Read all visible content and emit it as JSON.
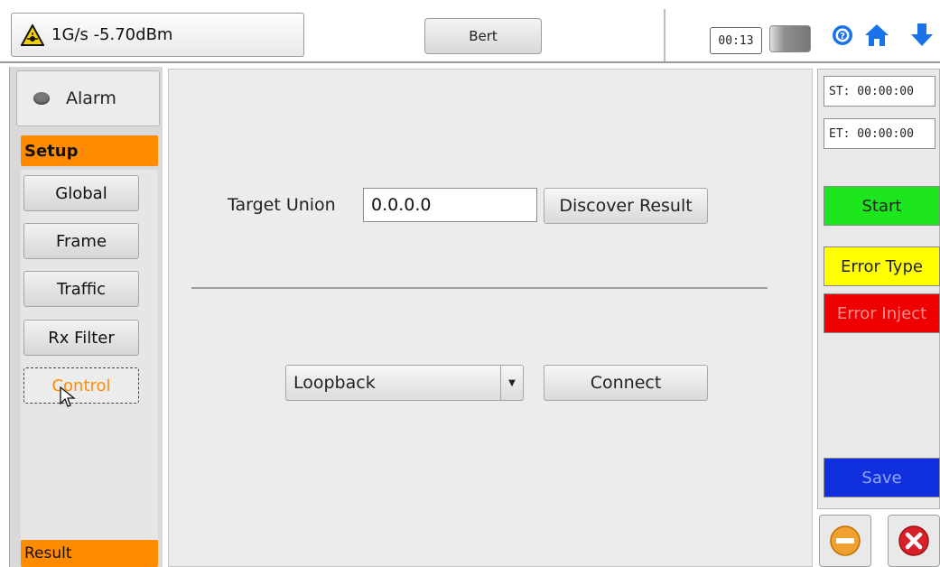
{
  "header": {
    "signal_text": "1G/s -5.70dBm",
    "mode_label": "Bert",
    "timer": "00:13"
  },
  "icons": {
    "warning": "laser-warning-icon",
    "battery": "battery-icon",
    "help": "help-icon",
    "home": "home-icon",
    "download": "down-arrow-icon"
  },
  "sidebar": {
    "alarm_label": "Alarm",
    "setup_header": "Setup",
    "items": [
      {
        "label": "Global"
      },
      {
        "label": "Frame"
      },
      {
        "label": "Traffic"
      },
      {
        "label": "Rx Filter"
      },
      {
        "label": "Control",
        "active": true
      }
    ],
    "result_header": "Result"
  },
  "main": {
    "target_union_label": "Target Union",
    "target_union_value": "0.0.0.0",
    "discover_button": "Discover Result",
    "mode_select_value": "Loopback",
    "connect_button": "Connect"
  },
  "right_panel": {
    "start_time": "ST:  00:00:00",
    "end_time": "ET:  00:00:00",
    "start_button": "Start",
    "error_type_button": "Error Type",
    "error_inject_button": "Error Inject",
    "save_button": "Save"
  },
  "colors": {
    "accent_orange": "#ff8c00",
    "start_green": "#1ee61e",
    "error_type_yellow": "#ffff00",
    "error_inject_red": "#ee0000",
    "save_blue": "#1030e0"
  }
}
